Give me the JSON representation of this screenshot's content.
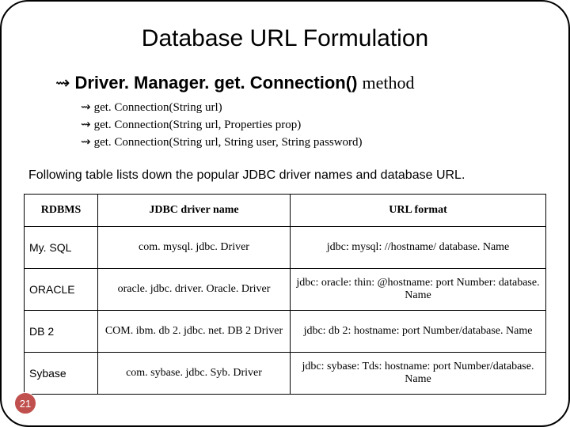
{
  "title": "Database URL Formulation",
  "main_bullet": {
    "bold_part": "Driver. Manager. get. Connection()",
    "rest": "method"
  },
  "sub_items": [
    "get. Connection(String url)",
    "get. Connection(String url, Properties prop)",
    "get. Connection(String url, String user, String password)"
  ],
  "body_text": "Following table lists down the popular JDBC driver names and database URL.",
  "table": {
    "headers": [
      "RDBMS",
      "JDBC driver name",
      "URL format"
    ],
    "rows": [
      {
        "rdbms": "My. SQL",
        "driver": "com. mysql. jdbc. Driver",
        "url": "jdbc: mysql: //hostname/ database. Name"
      },
      {
        "rdbms": "ORACLE",
        "driver": "oracle. jdbc. driver. Oracle. Driver",
        "url": "jdbc: oracle: thin: @hostname: port Number: database. Name"
      },
      {
        "rdbms": "DB 2",
        "driver": "COM. ibm. db 2. jdbc. net. DB 2 Driver",
        "url": "jdbc: db 2: hostname: port Number/database. Name"
      },
      {
        "rdbms": "Sybase",
        "driver": "com. sybase. jdbc. Syb. Driver",
        "url": "jdbc: sybase: Tds: hostname: port Number/database. Name"
      }
    ]
  },
  "page_number": "21",
  "arrow_glyph": "⇝"
}
